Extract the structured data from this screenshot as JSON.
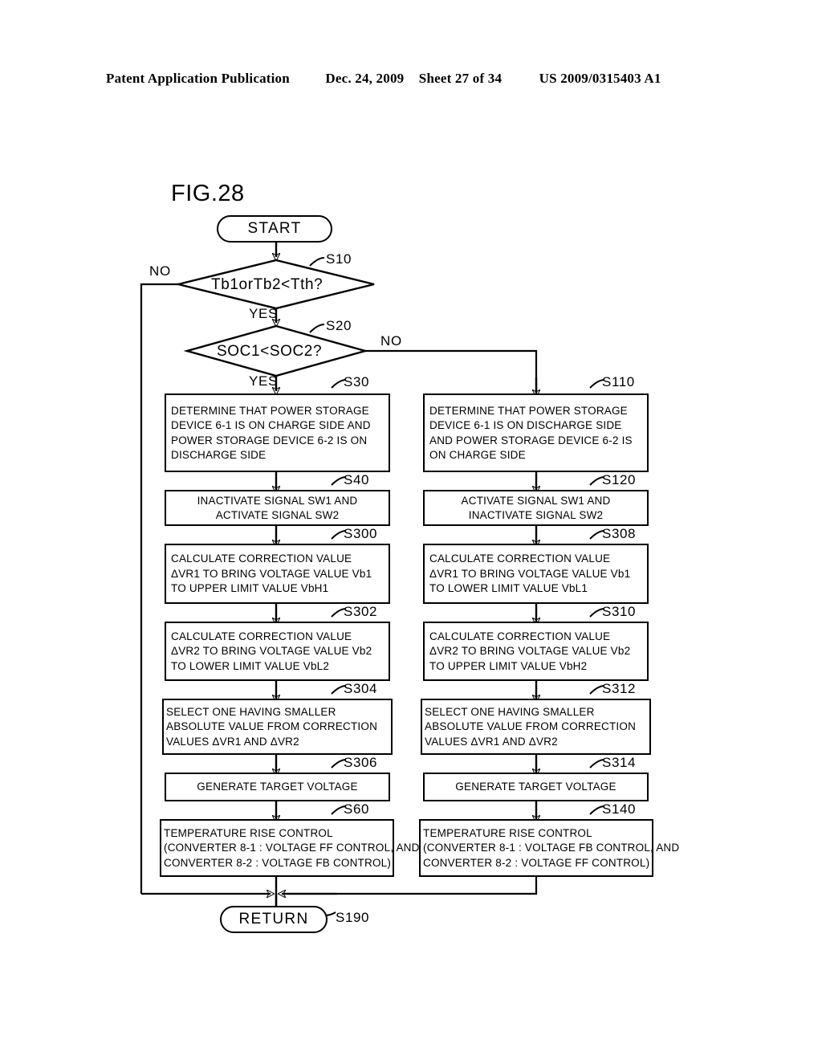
{
  "header": {
    "title": "Patent Application Publication",
    "date": "Dec. 24, 2009",
    "sheet": "Sheet 27 of 34",
    "patent_number": "US 2009/0315403 A1"
  },
  "figure": {
    "label": "FIG.28"
  },
  "nodes": {
    "start": {
      "label": "START"
    },
    "return": {
      "label": "RETURN",
      "step": "S190"
    },
    "s10": {
      "step": "S10",
      "text": "Tb1orTb2<Tth?",
      "yes_label": "YES",
      "no_label": "NO"
    },
    "s20": {
      "step": "S20",
      "text": "SOC1<SOC2?",
      "yes_label": "YES",
      "no_label": "NO"
    },
    "s30": {
      "step": "S30",
      "lines": [
        "DETERMINE THAT POWER STORAGE",
        "DEVICE 6-1 IS ON CHARGE SIDE AND",
        "POWER STORAGE DEVICE 6-2 IS ON",
        "DISCHARGE SIDE"
      ]
    },
    "s40": {
      "step": "S40",
      "lines": [
        "INACTIVATE SIGNAL SW1 AND",
        "ACTIVATE SIGNAL SW2"
      ]
    },
    "s300": {
      "step": "S300",
      "lines": [
        "CALCULATE CORRECTION VALUE",
        "ΔVR1 TO BRING VOLTAGE VALUE Vb1",
        "TO UPPER LIMIT VALUE VbH1"
      ]
    },
    "s302": {
      "step": "S302",
      "lines": [
        "CALCULATE CORRECTION VALUE",
        "ΔVR2 TO BRING VOLTAGE VALUE Vb2",
        "TO LOWER LIMIT VALUE VbL2"
      ]
    },
    "s304": {
      "step": "S304",
      "lines": [
        "SELECT ONE HAVING SMALLER",
        "ABSOLUTE VALUE FROM CORRECTION",
        "VALUES ΔVR1 AND ΔVR2"
      ]
    },
    "s306": {
      "step": "S306",
      "lines": [
        "GENERATE TARGET VOLTAGE"
      ]
    },
    "s60": {
      "step": "S60",
      "lines": [
        "TEMPERATURE RISE CONTROL",
        "(CONVERTER 8-1 : VOLTAGE FF CONTROL, AND",
        "CONVERTER 8-2 : VOLTAGE FB CONTROL)"
      ]
    },
    "s110": {
      "step": "S110",
      "lines": [
        "DETERMINE THAT POWER STORAGE",
        "DEVICE 6-1 IS ON DISCHARGE SIDE",
        "AND POWER STORAGE DEVICE 6-2 IS",
        "ON CHARGE SIDE"
      ]
    },
    "s120": {
      "step": "S120",
      "lines": [
        "ACTIVATE SIGNAL SW1 AND",
        "INACTIVATE SIGNAL SW2"
      ]
    },
    "s308": {
      "step": "S308",
      "lines": [
        "CALCULATE CORRECTION VALUE",
        "ΔVR1 TO BRING VOLTAGE VALUE Vb1",
        "TO LOWER LIMIT VALUE VbL1"
      ]
    },
    "s310": {
      "step": "S310",
      "lines": [
        "CALCULATE CORRECTION VALUE",
        "ΔVR2 TO BRING VOLTAGE VALUE Vb2",
        "TO UPPER LIMIT VALUE VbH2"
      ]
    },
    "s312": {
      "step": "S312",
      "lines": [
        "SELECT ONE HAVING SMALLER",
        "ABSOLUTE VALUE FROM CORRECTION",
        "VALUES ΔVR1 AND ΔVR2"
      ]
    },
    "s314": {
      "step": "S314",
      "lines": [
        "GENERATE TARGET VOLTAGE"
      ]
    },
    "s140": {
      "step": "S140",
      "lines": [
        "TEMPERATURE RISE CONTROL",
        "(CONVERTER 8-1 : VOLTAGE FB CONTROL, AND",
        "CONVERTER 8-2 : VOLTAGE FF CONTROL)"
      ]
    }
  },
  "colors": {
    "ink": "#000000",
    "paper": "#ffffff"
  }
}
